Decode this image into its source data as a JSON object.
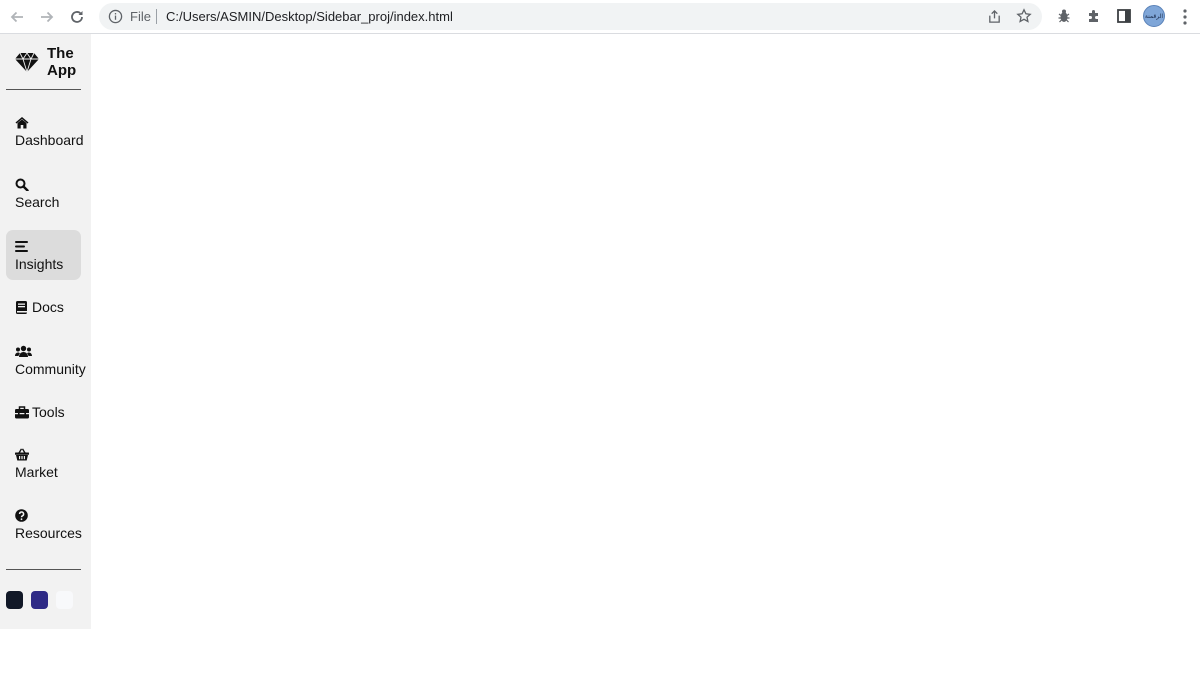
{
  "browser": {
    "scheme_label": "File",
    "url": "C:/Users/ASMIN/Desktop/Sidebar_proj/index.html",
    "avatar_text": "الرقمنة"
  },
  "sidebar": {
    "brand": {
      "title": "The App",
      "icon": "diamond-icon"
    },
    "items": [
      {
        "label": "Dashboard",
        "icon": "home-icon",
        "active": false
      },
      {
        "label": "Search",
        "icon": "search-icon",
        "active": false
      },
      {
        "label": "Insights",
        "icon": "bars-icon",
        "active": true
      },
      {
        "label": "Docs",
        "icon": "book-icon",
        "active": false
      },
      {
        "label": "Community",
        "icon": "users-icon",
        "active": false
      },
      {
        "label": "Tools",
        "icon": "toolbox-icon",
        "active": false
      },
      {
        "label": "Market",
        "icon": "basket-icon",
        "active": false
      },
      {
        "label": "Resources",
        "icon": "question-circle-icon",
        "active": false
      }
    ],
    "theme_swatches": [
      {
        "name": "dark",
        "color": "#111827"
      },
      {
        "name": "indigo",
        "color": "#2e2a86"
      },
      {
        "name": "light",
        "color": "#f8f9fb"
      }
    ]
  },
  "colors": {
    "sidebar_bg": "#f2f2f2",
    "active_item_bg": "#dcdcdc",
    "omnibox_bg": "#f1f3f4"
  }
}
